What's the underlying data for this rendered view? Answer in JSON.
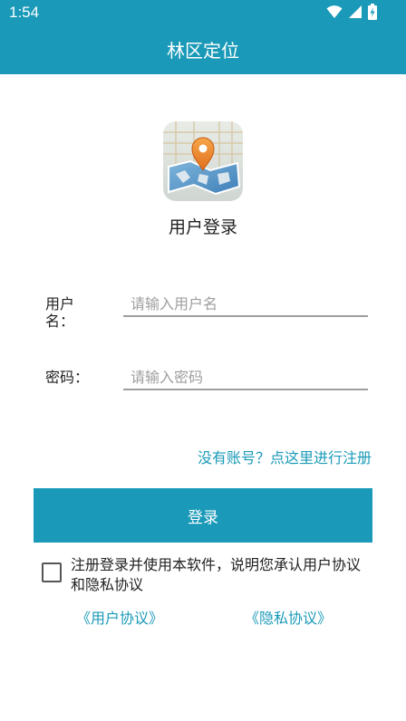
{
  "status_bar": {
    "time": "1:54"
  },
  "app_bar": {
    "title": "林区定位"
  },
  "colors": {
    "primary": "#1a9ab8",
    "text": "#222222",
    "placeholder": "#9e9e9e"
  },
  "header": {
    "logo_icon": "map-pin-icon",
    "subtitle": "用户登录"
  },
  "form": {
    "username_label_line1": "用户",
    "username_label_line2": "名：",
    "username_placeholder": "请输入用户名",
    "username_value": "",
    "password_label": "密码：",
    "password_placeholder": "请输入密码",
    "password_value": ""
  },
  "register_link": "没有账号？点这里进行注册",
  "login_button": "登录",
  "agreement": {
    "checked": false,
    "text": "注册登录并使用本软件，说明您承认用户协议和隐私协议",
    "user_agreement_link": "《用户协议》",
    "privacy_link": "《隐私协议》"
  }
}
